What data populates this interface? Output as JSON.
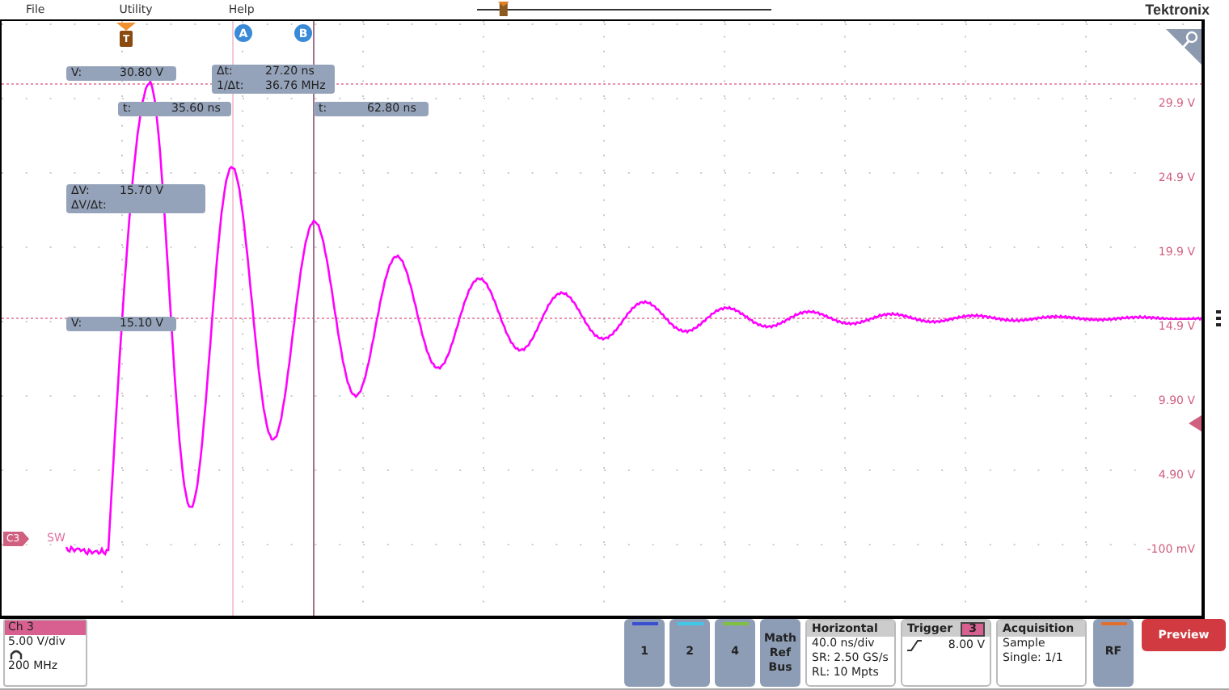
{
  "menu": [
    {
      "label": "File"
    },
    {
      "label": "Utility"
    },
    {
      "label": "Help"
    }
  ],
  "position_slider": {
    "level": 0.09
  },
  "brand": "Tektronix",
  "plot": {
    "trigger_marker": "T",
    "cursors": [
      {
        "label": "A"
      },
      {
        "label": "B"
      }
    ],
    "channel_tag": "C3",
    "trace_label": "SW",
    "scale_labels": [
      "29.9 V",
      "24.9 V",
      "19.9 V",
      "14.9 V",
      "9.90 V",
      "4.90 V",
      "-100 mV"
    ],
    "readouts": [
      {
        "lines": [
          {
            "label": "V:",
            "value": "30.80 V"
          }
        ]
      },
      {
        "lines": [
          {
            "label": "Δt:",
            "value": "27.20 ns"
          },
          {
            "label": "1/Δt:",
            "value": "36.76 MHz"
          }
        ]
      },
      {
        "lines": [
          {
            "label": "t:",
            "value": "35.60 ns"
          }
        ]
      },
      {
        "lines": [
          {
            "label": "t:",
            "value": "62.80 ns"
          }
        ]
      },
      {
        "lines": [
          {
            "label": "ΔV:",
            "value": "15.70 V"
          },
          {
            "label": "ΔV/Δt:"
          }
        ]
      },
      {
        "lines": [
          {
            "label": "V:",
            "value": "15.10 V"
          }
        ]
      }
    ]
  },
  "channel_badge": {
    "name": "Ch 3",
    "scale": "5.00 V/div",
    "bandwidth": "200 MHz"
  },
  "channel_buttons": [
    {
      "label": "1",
      "color": "#3a4fd0"
    },
    {
      "label": "2",
      "color": "#40c8e8"
    },
    {
      "label": "4",
      "color": "#80c040"
    }
  ],
  "math_button": [
    "Math",
    "Ref",
    "Bus"
  ],
  "horizontal": {
    "title": "Horizontal",
    "lines": [
      "40.0 ns/div",
      "SR: 2.50 GS/s",
      "RL: 10 Mpts"
    ]
  },
  "trigger": {
    "title": "Trigger",
    "source": "3",
    "level": "8.00 V"
  },
  "acquisition": {
    "title": "Acquisition",
    "lines": [
      "Sample",
      "Single: 1/1"
    ]
  },
  "rf_button": {
    "label": "RF",
    "color": "#e07030"
  },
  "preview_button": "Preview"
}
